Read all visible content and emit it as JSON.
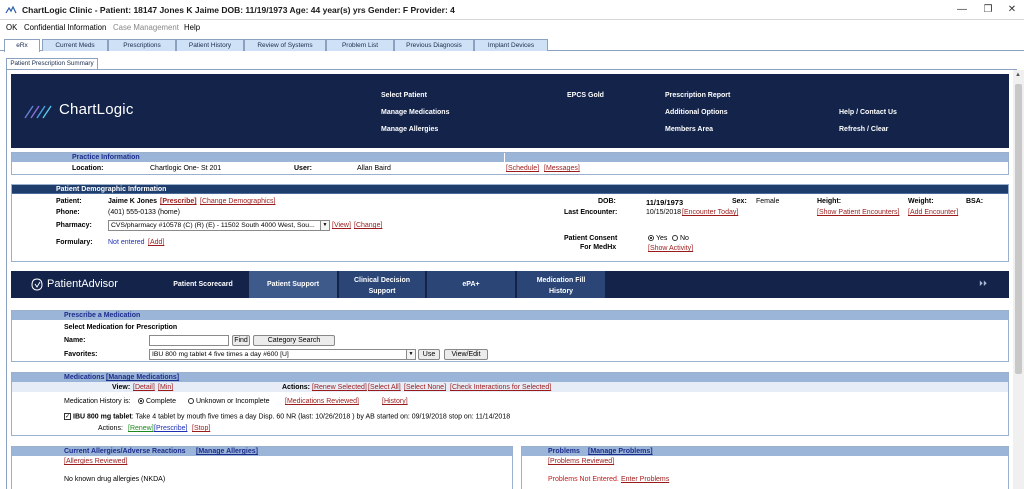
{
  "window": {
    "title": "ChartLogic Clinic - Patient: 18147 Jones K Jaime DOB: 11/19/1973 Age: 44 year(s) yrs Gender: F Provider: 4",
    "minimize": "—",
    "restore": "❐",
    "close": "✕"
  },
  "menu": [
    "OK",
    "Confidential Information",
    "Case Management",
    "Help"
  ],
  "tabs": [
    "eRx",
    "Current Meds",
    "Prescriptions",
    "Patient History",
    "Review of Systems",
    "Problem List",
    "Previous Diagnosis",
    "Implant Devices"
  ],
  "subtab": "Patient Prescription Summary",
  "header": {
    "logo": "ChartLogic",
    "nav": {
      "select_patient": "Select Patient",
      "manage_medications": "Manage Medications",
      "manage_allergies": "Manage Allergies",
      "epcs_gold": "EPCS Gold",
      "prescription_report": "Prescription Report",
      "additional_options": "Additional Options",
      "members_area": "Members Area",
      "help_contact": "Help / Contact Us",
      "refresh_clear": "Refresh / Clear"
    }
  },
  "practice": {
    "title": "Practice Information",
    "location_label": "Location:",
    "location": "Chartlogic One- St 201",
    "user_label": "User:",
    "user": "Allan Baird",
    "schedule": "[Schedule]",
    "messages": "[Messages]"
  },
  "demographics": {
    "title": "Patient Demographic Information",
    "patient_label": "Patient:",
    "patient": "Jaime K Jones",
    "prescribe": "[Prescribe]",
    "change_demographics": "[Change Demographics]",
    "phone_label": "Phone:",
    "phone": "(401) 555-0133 (home)",
    "pharmacy_label": "Pharmacy:",
    "pharmacy": "CVS/pharmacy #10578 (C) (R) (E) - 11502 South 4000 West, Sou...",
    "view": "[View]",
    "change": "[Change]",
    "formulary_label": "Formulary:",
    "formulary": "Not entered",
    "add": "[Add]",
    "dob_label": "DOB:",
    "dob": "11/19/1973",
    "sex_label": "Sex:",
    "sex": "Female",
    "height_label": "Height:",
    "weight_label": "Weight:",
    "bsa_label": "BSA:",
    "last_encounter_label": "Last Encounter:",
    "last_encounter": "10/15/2018",
    "encounter_today": "[Encounter Today]",
    "show_encounters": "[Show Patient Encounters]",
    "add_encounter": "[Add Encounter]",
    "consent_label_1": "Patient Consent",
    "consent_label_2": "For MedHx",
    "yes": "Yes",
    "no": "No",
    "show_activity": "[Show Activity]"
  },
  "patient_advisor": {
    "logo": "PatientAdvisor",
    "tabs": [
      "Patient Scorecard",
      "Patient Support",
      "Clinical Decision Support",
      "ePA+",
      "Medication Fill History"
    ],
    "expand": "⏵⏵"
  },
  "prescribe": {
    "title": "Prescribe a Medication",
    "select_label": "Select Medication for Prescription",
    "name_label": "Name:",
    "find": "Find",
    "category_search": "Category Search",
    "favorites_label": "Favorites:",
    "favorite_value": "IBU 800 mg tablet 4 five times a day #600 [U]",
    "use": "Use",
    "view_edit": "View/Edit"
  },
  "medications": {
    "title": "Medications",
    "manage": "[Manage Medications]",
    "view_label": "View:",
    "detail": "[Detail]",
    "min": "[Min]",
    "actions_label": "Actions:",
    "renew_selected": "[Renew Selected]",
    "select_all": "[Select All]",
    "select_none": "[Select None]",
    "check_interactions": "[Check Interactions for Selected]",
    "history_label": "Medication History is:",
    "complete": "Complete",
    "unknown": "Unknown or Incomplete",
    "reviewed": "[Medications Reviewed]",
    "history": "[History]",
    "med_name": "IBU 800 mg tablet",
    "med_detail": ": Take 4 tablet by mouth five times a day Disp. 60 NR (last: 10/26/2018 ) by AB started on: 09/19/2018 stop on: 11/14/2018",
    "row_actions_label": "Actions:",
    "renew": "[Renew]",
    "row_prescribe": "[Prescribe]",
    "stop": "[Stop]"
  },
  "allergies": {
    "title": "Current Allergies/Adverse Reactions",
    "manage": "[Manage Allergies]",
    "reviewed": "[Allergies Reviewed]",
    "none": "No known drug allergies (NKDA)"
  },
  "problems": {
    "title": "Problems",
    "manage": "[Manage Problems]",
    "reviewed": "[Problems Reviewed]",
    "not_entered": "Problems Not Entered.",
    "enter": "Enter Problems"
  }
}
